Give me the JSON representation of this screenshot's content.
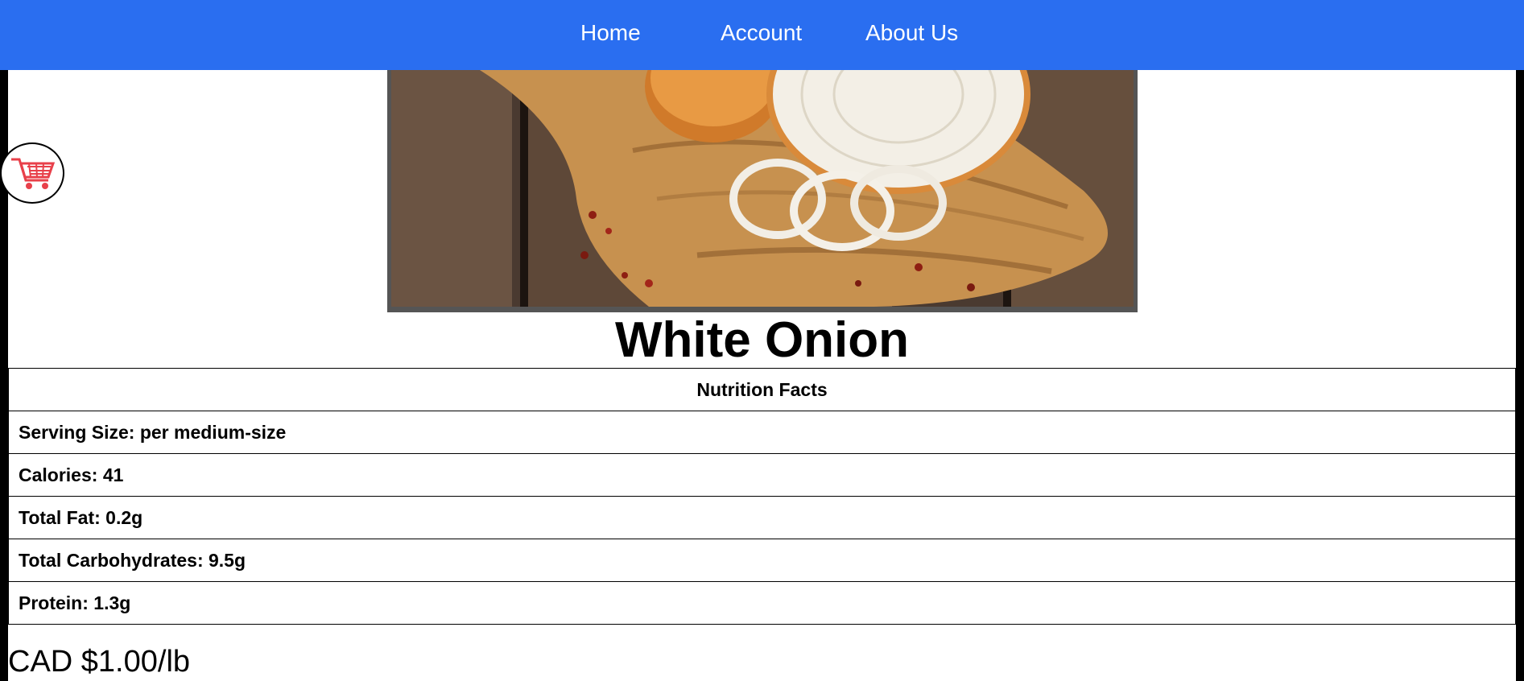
{
  "nav": {
    "links": [
      {
        "label": "Home"
      },
      {
        "label": "Account"
      },
      {
        "label": "About Us"
      }
    ],
    "color": "#2a6ef0"
  },
  "cart": {
    "icon": "shopping-cart-icon"
  },
  "product": {
    "title": "White Onion",
    "image_alt": "White onion halves and rings on a wooden cutting board",
    "price": "CAD $1.00/lb"
  },
  "nutrition": {
    "heading": "Nutrition Facts",
    "rows": [
      "Serving Size: per medium-size",
      "Calories: 41",
      "Total Fat: 0.2g",
      "Total Carbohydrates: 9.5g",
      "Protein: 1.3g"
    ]
  }
}
